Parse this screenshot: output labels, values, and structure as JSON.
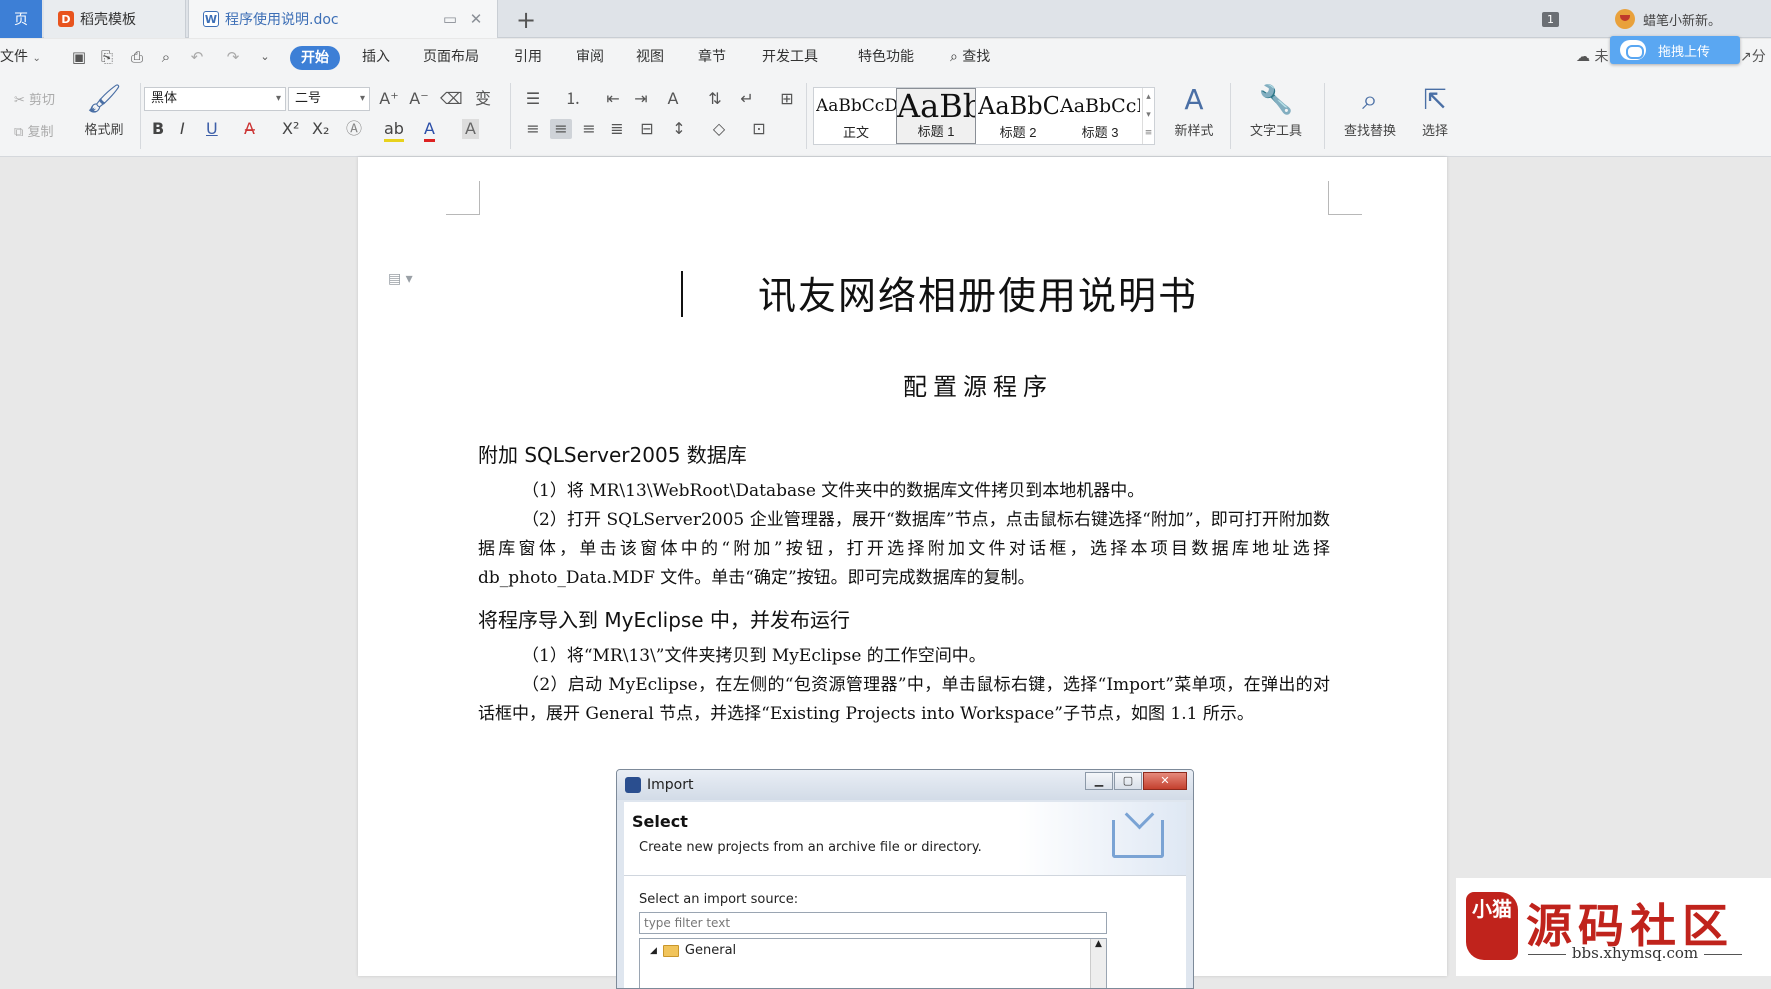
{
  "tabs": {
    "home": "页",
    "template": "稻壳模板",
    "doc": "程序使用说明.doc",
    "new_tab": "+"
  },
  "topright": {
    "window_count": "1",
    "user": "蜡笔小新新。"
  },
  "menu": {
    "file": "文件",
    "items": [
      "开始",
      "插入",
      "页面布局",
      "引用",
      "审阅",
      "视图",
      "章节",
      "开发工具",
      "特色功能"
    ],
    "search": "查找",
    "upload": "拖拽上传",
    "right_cut": "未",
    "share_cut": "分"
  },
  "ribbon": {
    "cut": "剪切",
    "copy": "复制",
    "format_painter": "格式刷",
    "font_name": "黑体",
    "font_size": "二号",
    "styles": [
      {
        "sample": "AaBbCcDd",
        "label": "正文"
      },
      {
        "sample": "AaBb",
        "label": "标题 1"
      },
      {
        "sample": "AaBbC",
        "label": "标题 2"
      },
      {
        "sample": "AaBbCcI",
        "label": "标题 3"
      }
    ],
    "new_style": "新样式",
    "text_tools": "文字工具",
    "find_replace": "查找替换",
    "select": "选择"
  },
  "document": {
    "title": "讯友网络相册使用说明书",
    "subtitle": "配置源程序",
    "section1": {
      "heading": "附加 SQLServer2005 数据库",
      "p1": "（1）将 MR\\13\\WebRoot\\Database 文件夹中的数据库文件拷贝到本地机器中。",
      "p2": "（2）打开 SQLServer2005 企业管理器，展开“数据库”节点，点击鼠标右键选择“附加”，即可打开附加数据库窗体，单击该窗体中的“附加”按钮，打开选择附加文件对话框，选择本项目数据库地址选择 db_photo_Data.MDF 文件。单击“确定”按钮。即可完成数据库的复制。"
    },
    "section2": {
      "heading": "将程序导入到 MyEclipse 中，并发布运行",
      "p1": "（1）将“MR\\13\\”文件夹拷贝到 MyEclipse 的工作空间中。",
      "p2": "（2）启动 MyEclipse，在左侧的“包资源管理器”中，单击鼠标右键，选择“Import”菜单项，在弹出的对话框中，展开 General 节点，并选择“Existing Projects into Workspace”子节点，如图 1.1 所示。"
    }
  },
  "dialog": {
    "title": "Import",
    "heading": "Select",
    "description": "Create new projects from an archive file or directory.",
    "source_label": "Select an import source:",
    "filter_placeholder": "type filter text",
    "tree_node": "General"
  },
  "watermark": {
    "seal": "小猫",
    "brand": "源码社区",
    "url": "bbs.xhymsq.com"
  },
  "colors": {
    "accent": "#3d7fd6",
    "upload": "#5aa7f2",
    "watermark": "#c0231c"
  }
}
